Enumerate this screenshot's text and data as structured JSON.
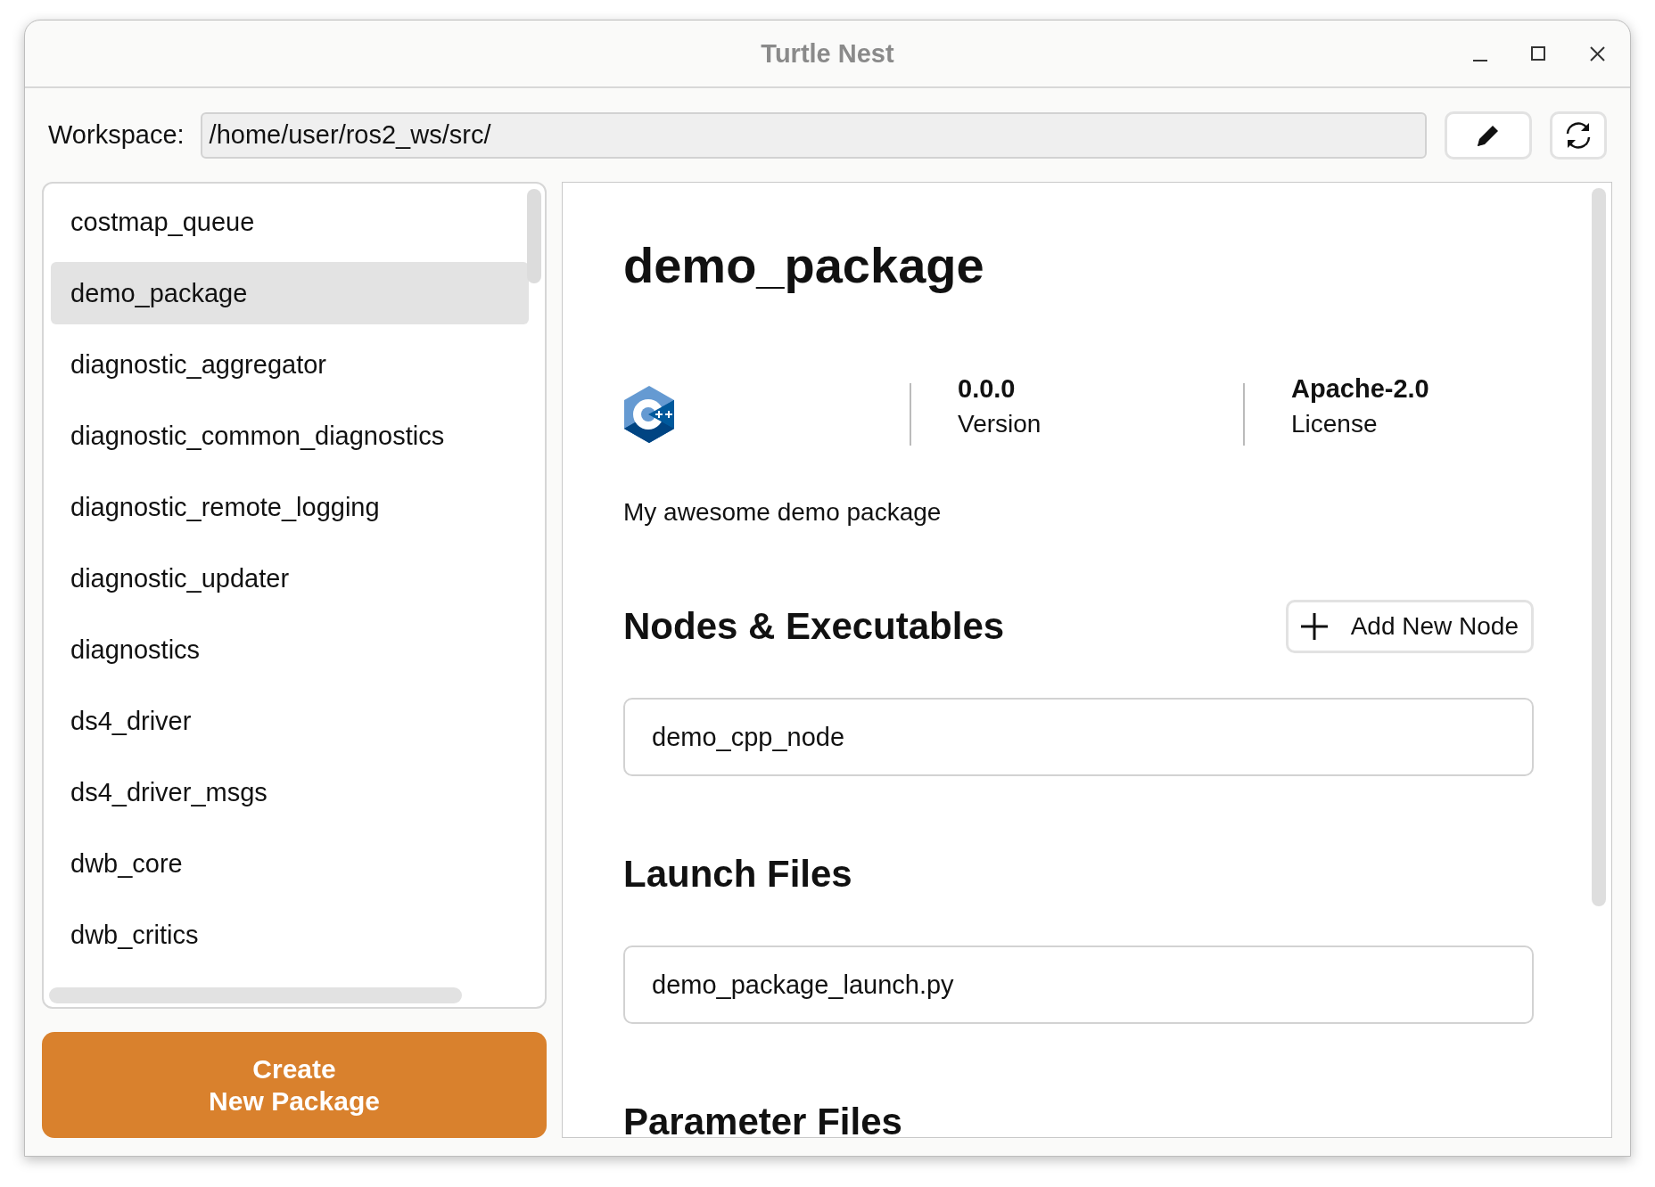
{
  "window": {
    "title": "Turtle Nest"
  },
  "workspace": {
    "label": "Workspace:",
    "value": "/home/user/ros2_ws/src/"
  },
  "packages": [
    {
      "name": "costmap_queue",
      "selected": false
    },
    {
      "name": "demo_package",
      "selected": true
    },
    {
      "name": "diagnostic_aggregator",
      "selected": false
    },
    {
      "name": "diagnostic_common_diagnostics",
      "selected": false
    },
    {
      "name": "diagnostic_remote_logging",
      "selected": false
    },
    {
      "name": "diagnostic_updater",
      "selected": false
    },
    {
      "name": "diagnostics",
      "selected": false
    },
    {
      "name": "ds4_driver",
      "selected": false
    },
    {
      "name": "ds4_driver_msgs",
      "selected": false
    },
    {
      "name": "dwb_core",
      "selected": false
    },
    {
      "name": "dwb_critics",
      "selected": false
    }
  ],
  "create_button": "Create\nNew Package",
  "package": {
    "name": "demo_package",
    "kind": "cpp",
    "version": "0.0.0",
    "version_label": "Version",
    "license": "Apache-2.0",
    "license_label": "License",
    "description": "My awesome demo package",
    "sections": [
      {
        "title": "Nodes & Executables",
        "button": "Add New Node",
        "items": [
          "demo_cpp_node"
        ]
      },
      {
        "title": "Launch Files",
        "items": [
          "demo_package_launch.py"
        ]
      },
      {
        "title": "Parameter Files"
      }
    ]
  }
}
